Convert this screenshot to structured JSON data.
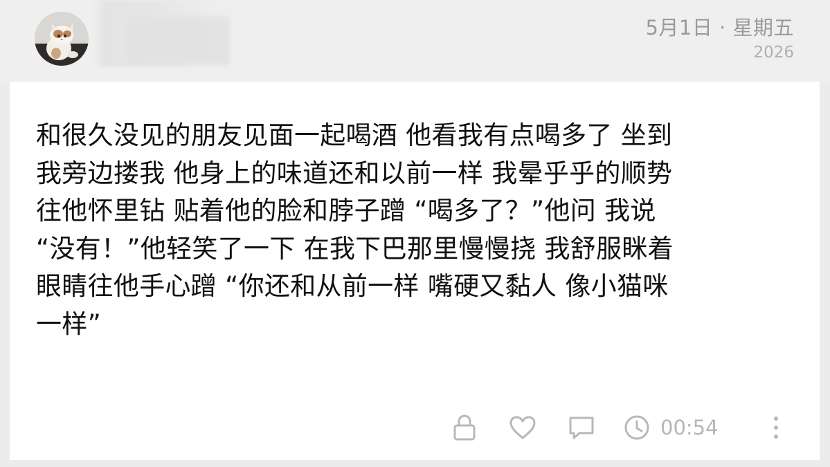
{
  "header": {
    "date": "5月1日 · 星期五",
    "year": "2026"
  },
  "post": {
    "lines": [
      "和很久没见的朋友见面一起喝酒 他看我有点喝多了 坐到",
      "我旁边搂我 他身上的味道还和以前一样 我晕乎乎的顺势",
      "往他怀里钻 贴着他的脸和脖子蹭 “喝多了？”他问 我说",
      "“没有！”他轻笑了一下 在我下巴那里慢慢挠 我舒服眯着",
      "眼睛往他手心蹭 “你还和从前一样 嘴硬又黏人 像小猫咪",
      "一样”"
    ]
  },
  "actions": {
    "timer": "00:54",
    "icons": [
      "lock-icon",
      "heart-icon",
      "comment-icon",
      "clock-icon",
      "more-icon"
    ]
  },
  "colors": {
    "background": "#ececec",
    "card": "#ffffff",
    "text": "#111111",
    "muted": "#9a9a9a",
    "icon": "#b8b8b8"
  }
}
